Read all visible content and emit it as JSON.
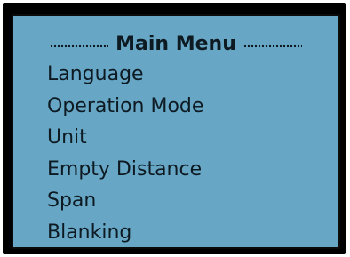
{
  "menu": {
    "title": "Main Menu",
    "items": [
      {
        "label": "Language"
      },
      {
        "label": "Operation Mode"
      },
      {
        "label": "Unit"
      },
      {
        "label": "Empty Distance"
      },
      {
        "label": "Span"
      },
      {
        "label": "Blanking"
      }
    ]
  },
  "colors": {
    "screen_background": "#67a6c5",
    "frame": "#000000",
    "text": "#0d1a22"
  }
}
